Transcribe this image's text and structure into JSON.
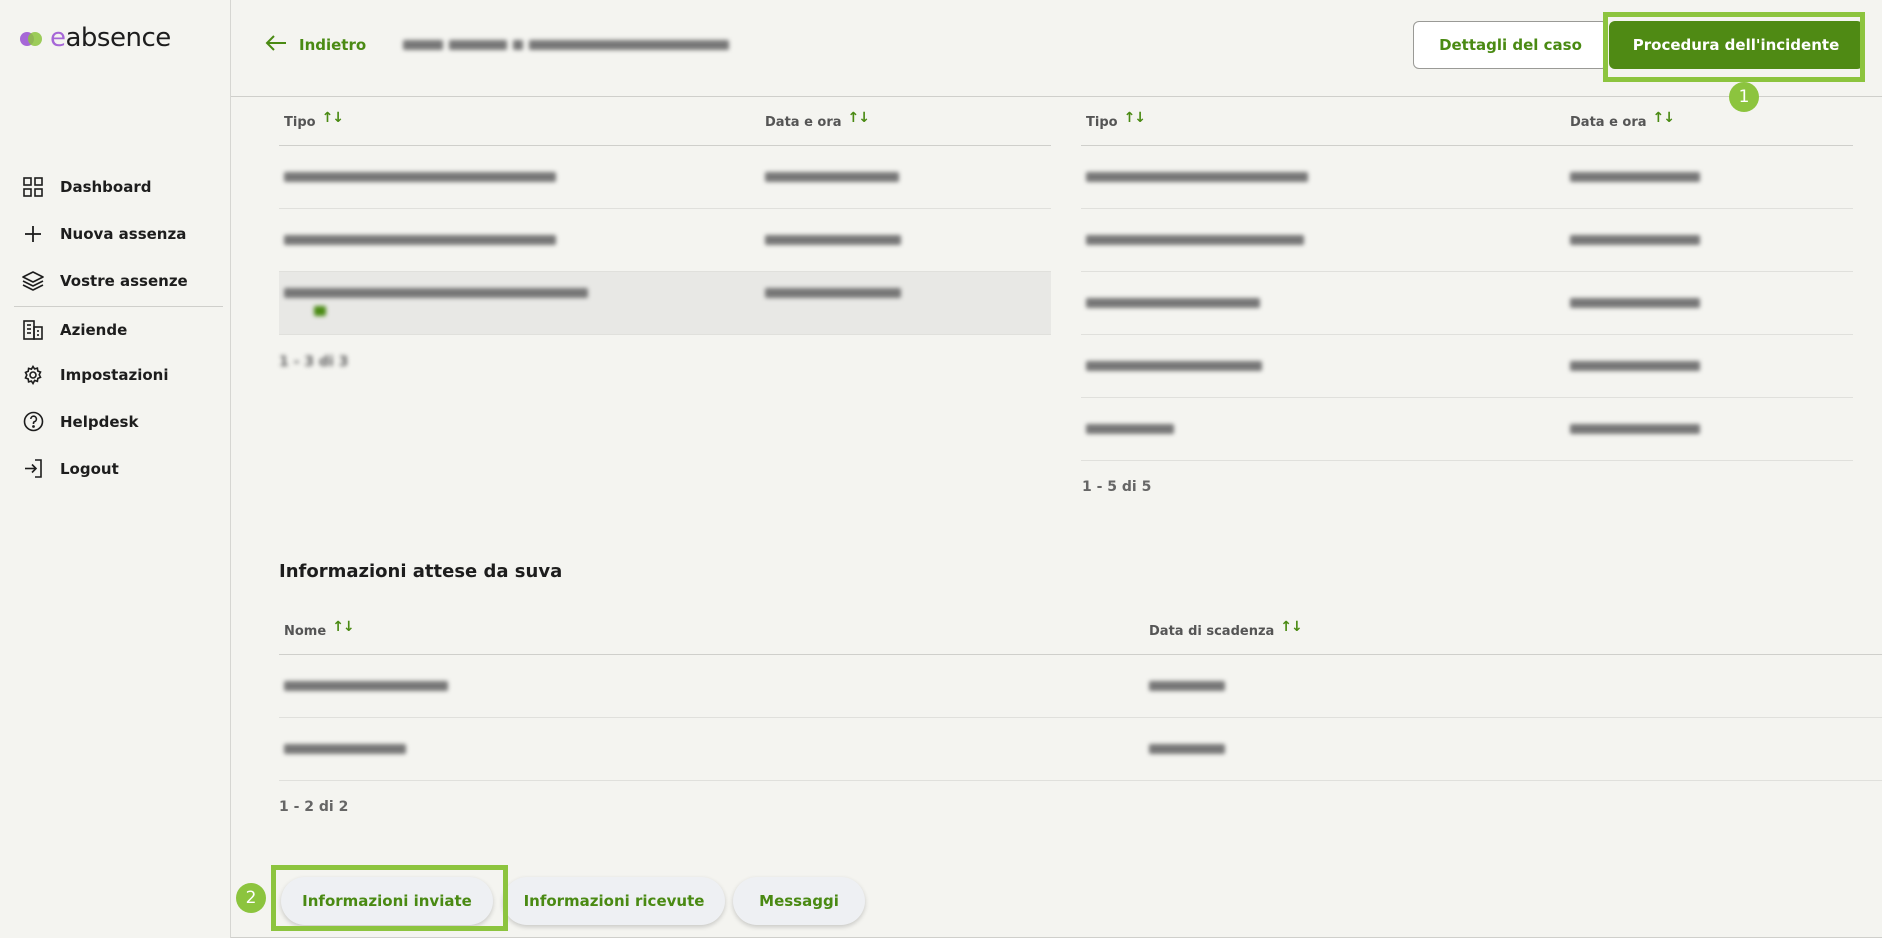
{
  "logo": {
    "text_e": "e",
    "text_rest": "absence"
  },
  "nav": [
    {
      "label": "Dashboard",
      "icon": "grid-icon"
    },
    {
      "label": "Nuova assenza",
      "icon": "plus-icon"
    },
    {
      "label": "Vostre assenze",
      "icon": "layers-icon"
    },
    {
      "label": "Aziende",
      "icon": "building-icon"
    },
    {
      "label": "Impostazioni",
      "icon": "gear-icon"
    },
    {
      "label": "Helpdesk",
      "icon": "help-icon"
    },
    {
      "label": "Logout",
      "icon": "logout-icon"
    }
  ],
  "header": {
    "back_label": "Indietro",
    "case_details_label": "Dettagli del caso",
    "incident_procedure_label": "Procedura dell'incidente"
  },
  "left_table": {
    "col_type": "Tipo",
    "col_datetime": "Data e ora",
    "pager": "1 - 3 di 3"
  },
  "right_table": {
    "col_type": "Tipo",
    "col_datetime": "Data e ora",
    "pager": "1 - 5 di 5"
  },
  "expected_info": {
    "title": "Informazioni attese da suva",
    "col_name": "Nome",
    "col_due": "Data di scadenza",
    "pager": "1 - 2 di 2"
  },
  "tabs": {
    "sent": "Informazioni inviate",
    "received": "Informazioni ricevute",
    "messages": "Messaggi"
  },
  "annotations": {
    "one": "1",
    "two": "2"
  },
  "colors": {
    "accent": "#4f8a14",
    "highlight": "#8cc43e",
    "logo_purple": "#a667d7"
  }
}
